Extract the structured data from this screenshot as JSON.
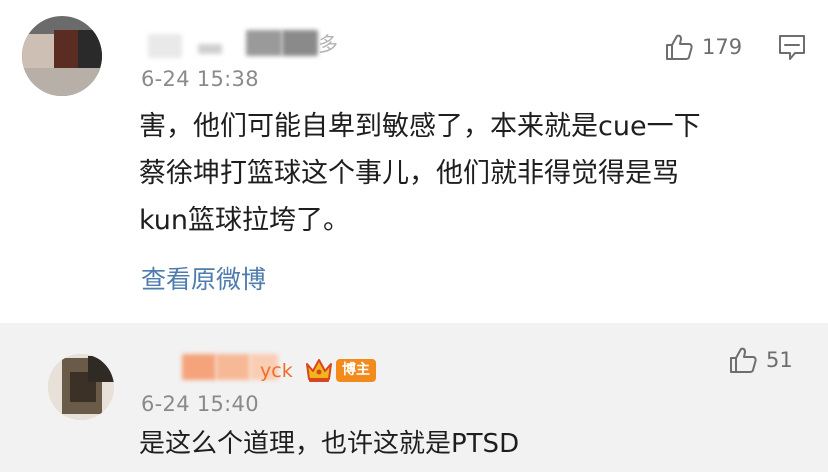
{
  "comment1": {
    "name_fragment": "多",
    "time": "6-24 15:38",
    "likes": "179",
    "text_lines": [
      "害，他们可能自卑到敏感了，本来就是cue一下",
      "蔡徐坤打篮球这个事儿，他们就非得觉得是骂",
      "kun篮球拉垮了。"
    ],
    "view_original_link": "查看原微博",
    "icons": {
      "like": "thumbs-up-icon",
      "reply": "comment-bubble-icon"
    }
  },
  "comment2": {
    "name_fragment": "yck",
    "badge": "博主",
    "time": "6-24 15:40",
    "likes": "51",
    "text": "是这么个道理，也许这就是PTSD",
    "icons": {
      "like": "thumbs-up-icon",
      "crown": "crown-icon"
    }
  },
  "colors": {
    "link": "#4f7cae",
    "badge": "#f28a1c",
    "reply_background": "#f2f2f2",
    "meta_text": "#8a8a8a"
  }
}
